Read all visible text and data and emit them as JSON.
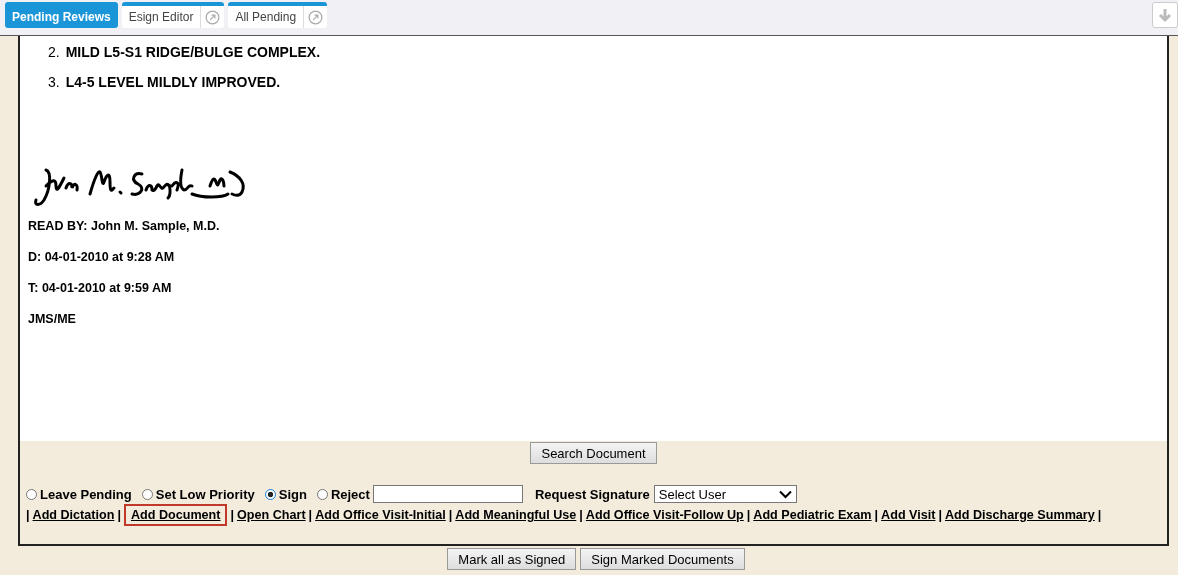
{
  "tabs": [
    {
      "label": "Pending Reviews",
      "selected": true,
      "popout": false
    },
    {
      "label": "Esign Editor",
      "selected": false,
      "popout": true
    },
    {
      "label": "All Pending",
      "selected": false,
      "popout": true
    }
  ],
  "findings": [
    {
      "number": "2.",
      "text": "MILD L5-S1 RIDGE/BULGE COMPLEX."
    },
    {
      "number": "3.",
      "text": "L4-5 LEVEL MILDLY IMPROVED."
    }
  ],
  "signature_lines": [
    "READ BY: John M. Sample, M.D.",
    "D: 04-01-2010 at 9:28 AM",
    "T: 04-01-2010 at 9:59 AM",
    "JMS/ME"
  ],
  "search_button": "Search Document",
  "actions": [
    {
      "label": "Leave Pending",
      "selected": false
    },
    {
      "label": "Set Low Priority",
      "selected": false
    },
    {
      "label": "Sign",
      "selected": true
    },
    {
      "label": "Reject",
      "selected": false
    }
  ],
  "request_signature": {
    "label": "Request Signature",
    "value": "Select User"
  },
  "links": [
    {
      "kind": "sep",
      "text": "|"
    },
    {
      "kind": "link",
      "text": "Add Dictation",
      "highlighted": false
    },
    {
      "kind": "sep",
      "text": "|"
    },
    {
      "kind": "link",
      "text": "Add Document",
      "highlighted": true
    },
    {
      "kind": "sep",
      "text": "|"
    },
    {
      "kind": "link",
      "text": "Open Chart",
      "highlighted": false
    },
    {
      "kind": "sep",
      "text": "|"
    },
    {
      "kind": "link",
      "text": "Add Office Visit-Initial",
      "highlighted": false
    },
    {
      "kind": "sep",
      "text": "|"
    },
    {
      "kind": "link",
      "text": "Add Meaningful Use",
      "highlighted": false
    },
    {
      "kind": "sep",
      "text": "|"
    },
    {
      "kind": "link",
      "text": "Add Office Visit-Follow Up",
      "highlighted": false
    },
    {
      "kind": "sep",
      "text": "|"
    },
    {
      "kind": "link",
      "text": "Add Pediatric Exam",
      "highlighted": false
    },
    {
      "kind": "sep",
      "text": "|"
    },
    {
      "kind": "link",
      "text": "Add Visit",
      "highlighted": false
    },
    {
      "kind": "sep",
      "text": "|"
    },
    {
      "kind": "link",
      "text": "Add Discharge Summary",
      "highlighted": false
    },
    {
      "kind": "sep",
      "text": "|"
    }
  ],
  "bottom_buttons": [
    "Mark all as Signed",
    "Sign Marked Documents"
  ]
}
